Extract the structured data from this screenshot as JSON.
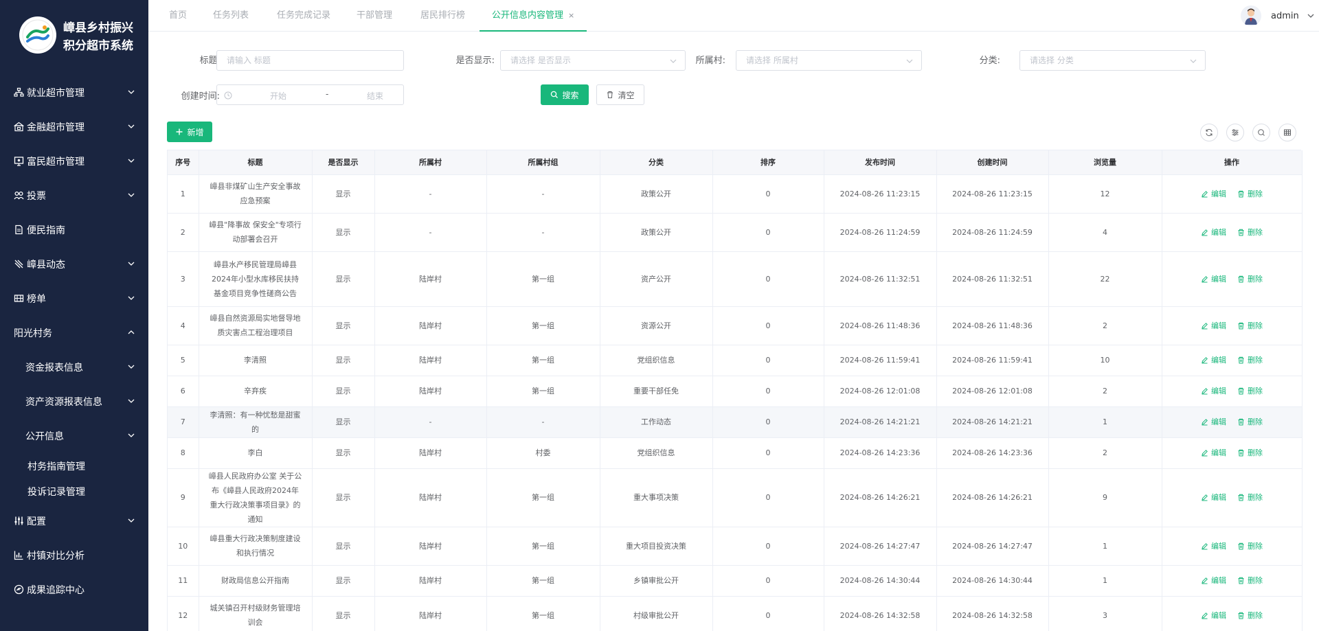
{
  "app": {
    "title_line1": "嶂县乡村振兴",
    "title_line2": "积分超市系统"
  },
  "sidebar": {
    "items": [
      {
        "label": "",
        "icon": "people-icon",
        "cut": true
      },
      {
        "label": "就业超市管理",
        "icon": "org-icon",
        "caret": "down"
      },
      {
        "label": "金融超市管理",
        "icon": "bank-icon",
        "caret": "down"
      },
      {
        "label": "富民超市管理",
        "icon": "monitor-icon",
        "caret": "down"
      },
      {
        "label": "投票",
        "icon": "vote-icon",
        "caret": "down"
      },
      {
        "label": "便民指南",
        "icon": "document-icon"
      },
      {
        "label": "嶂县动态",
        "icon": "edit-pen-icon",
        "caret": "down"
      },
      {
        "label": "榜单",
        "icon": "board-icon",
        "caret": "down"
      },
      {
        "label": "阳光村务",
        "caret": "up",
        "section": true
      },
      {
        "label": "资金报表信息",
        "caret": "down",
        "sub": true
      },
      {
        "label": "资产资源报表信息",
        "caret": "down",
        "sub": true
      },
      {
        "label": "公开信息",
        "caret": "down",
        "sub": true
      },
      {
        "label": "村务指南管理",
        "sub2": true
      },
      {
        "label": "投诉记录管理",
        "sub2": true
      },
      {
        "label": "配置",
        "icon": "sliders-icon",
        "caret": "down"
      },
      {
        "label": "村镇对比分析",
        "icon": "chart-icon"
      },
      {
        "label": "成果追踪中心",
        "icon": "target-icon"
      }
    ]
  },
  "tabs": [
    {
      "label": "首页"
    },
    {
      "label": "任务列表"
    },
    {
      "label": "任务完成记录"
    },
    {
      "label": "干部管理"
    },
    {
      "label": "居民排行榜"
    },
    {
      "label": "公开信息内容管理",
      "active": true,
      "close": "×"
    }
  ],
  "user": {
    "name": "admin"
  },
  "search": {
    "title_label": "标题:",
    "title_placeholder": "请输入 标题",
    "show_label": "是否显示:",
    "show_placeholder": "请选择 是否显示",
    "village_label": "所属村:",
    "village_placeholder": "请选择 所属村",
    "category_label": "分类:",
    "category_placeholder": "请选择 分类",
    "created_label": "创建时间:",
    "date_start": "开始",
    "date_sep": "-",
    "date_end": "结束",
    "search_btn": "搜索",
    "clear_btn": "清空"
  },
  "toolbar": {
    "add_btn": "新增"
  },
  "colors": {
    "primary": "#19b77b",
    "sidebar_bg": "#1a2540"
  },
  "table": {
    "columns": [
      "序号",
      "标题",
      "是否显示",
      "所属村",
      "所属村组",
      "分类",
      "排序",
      "发布时间",
      "创建时间",
      "浏览量",
      "操作"
    ],
    "edit_label": "编辑",
    "delete_label": "删除",
    "rows": [
      {
        "no": "1",
        "title": "嶂县非煤矿山生产安全事故应急预案",
        "show": "显示",
        "village": "-",
        "group": "-",
        "category": "政策公开",
        "sort": "0",
        "publish": "2024-08-26 11:23:15",
        "created": "2024-08-26 11:23:15",
        "views": "12"
      },
      {
        "no": "2",
        "title": "嶂县\"降事故 保安全\"专项行动部署会召开",
        "show": "显示",
        "village": "-",
        "group": "-",
        "category": "政策公开",
        "sort": "0",
        "publish": "2024-08-26 11:24:59",
        "created": "2024-08-26 11:24:59",
        "views": "4"
      },
      {
        "no": "3",
        "title": "嶂县水产移民管理局嶂县2024年小型水库移民扶持基金项目竞争性磋商公告",
        "show": "显示",
        "village": "陆岸村",
        "group": "第一组",
        "category": "资产公开",
        "sort": "0",
        "publish": "2024-08-26 11:32:51",
        "created": "2024-08-26 11:32:51",
        "views": "22"
      },
      {
        "no": "4",
        "title": "嶂县自然资源局实地督导地质灾害点工程治理项目",
        "show": "显示",
        "village": "陆岸村",
        "group": "第一组",
        "category": "资源公开",
        "sort": "0",
        "publish": "2024-08-26 11:48:36",
        "created": "2024-08-26 11:48:36",
        "views": "2"
      },
      {
        "no": "5",
        "title": "李清照",
        "show": "显示",
        "village": "陆岸村",
        "group": "第一组",
        "category": "党组织信息",
        "sort": "0",
        "publish": "2024-08-26 11:59:41",
        "created": "2024-08-26 11:59:41",
        "views": "10"
      },
      {
        "no": "6",
        "title": "辛弃疾",
        "show": "显示",
        "village": "陆岸村",
        "group": "第一组",
        "category": "重要干部任免",
        "sort": "0",
        "publish": "2024-08-26 12:01:08",
        "created": "2024-08-26 12:01:08",
        "views": "2"
      },
      {
        "no": "7",
        "title": "李清照：有一种忧愁是甜蜜的",
        "show": "显示",
        "village": "-",
        "group": "-",
        "category": "工作动态",
        "sort": "0",
        "publish": "2024-08-26 14:21:21",
        "created": "2024-08-26 14:21:21",
        "views": "1",
        "hover": true
      },
      {
        "no": "8",
        "title": "李白",
        "show": "显示",
        "village": "陆岸村",
        "group": "村委",
        "category": "党组织信息",
        "sort": "0",
        "publish": "2024-08-26 14:23:36",
        "created": "2024-08-26 14:23:36",
        "views": "2"
      },
      {
        "no": "9",
        "title": "嶂县人民政府办公室 关于公布《嶂县人民政府2024年重大行政决策事项目录》的通知",
        "show": "显示",
        "village": "陆岸村",
        "group": "第一组",
        "category": "重大事项决策",
        "sort": "0",
        "publish": "2024-08-26 14:26:21",
        "created": "2024-08-26 14:26:21",
        "views": "9"
      },
      {
        "no": "10",
        "title": "嶂县重大行政决策制度建设和执行情况",
        "show": "显示",
        "village": "陆岸村",
        "group": "第一组",
        "category": "重大项目投资决策",
        "sort": "0",
        "publish": "2024-08-26 14:27:47",
        "created": "2024-08-26 14:27:47",
        "views": "1"
      },
      {
        "no": "11",
        "title": "财政局信息公开指南",
        "show": "显示",
        "village": "陆岸村",
        "group": "第一组",
        "category": "乡镇审批公开",
        "sort": "0",
        "publish": "2024-08-26 14:30:44",
        "created": "2024-08-26 14:30:44",
        "views": "1"
      },
      {
        "no": "12",
        "title": "城关镇召开村级财务管理培训会",
        "show": "显示",
        "village": "陆岸村",
        "group": "第一组",
        "category": "村级审批公开",
        "sort": "0",
        "publish": "2024-08-26 14:32:58",
        "created": "2024-08-26 14:32:58",
        "views": "3"
      }
    ]
  }
}
